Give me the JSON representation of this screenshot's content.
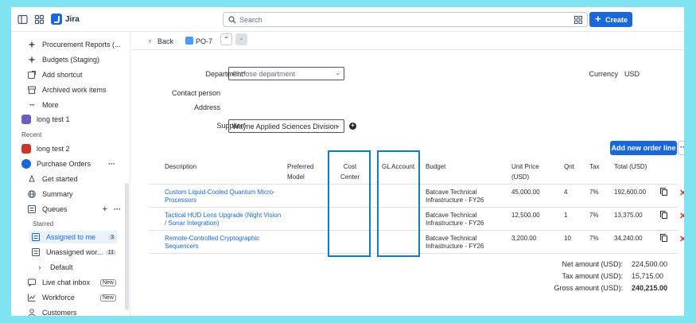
{
  "app": {
    "name": "Jira"
  },
  "search": {
    "placeholder": "Search"
  },
  "topbar": {
    "create_label": "Create"
  },
  "sidebar": {
    "items_top": [
      {
        "label": "Procurement Reports (...",
        "icon": "sparkle-icon"
      },
      {
        "label": "Budgets (Staging)",
        "icon": "sparkle-icon"
      },
      {
        "label": "Add shortcut",
        "icon": "add-shortcut-icon"
      },
      {
        "label": "Archived work items",
        "icon": "archive-icon"
      },
      {
        "label": "More",
        "icon": "more-icon"
      }
    ],
    "long_test_1": "long test 1",
    "recent_heading": "Recent",
    "long_test_2": "long test 2",
    "purchase_orders": "Purchase Orders",
    "get_started": "Get started",
    "summary": "Summary",
    "queues": "Queues",
    "starred_heading": "Starred",
    "assigned_to_me": "Assigned to me",
    "assigned_count": "3",
    "unassigned": "Unassigned wor...",
    "unassigned_count": "11",
    "default": "Default",
    "live_chat": "Live chat inbox",
    "live_chat_badge": "New",
    "workforce": "Workforce",
    "workforce_badge": "New",
    "customers": "Customers"
  },
  "breadcrumb": {
    "back": "Back",
    "issue_key": "PO-7"
  },
  "form": {
    "department_label": "Department*",
    "department_placeholder": "Choose department",
    "currency_label": "Currency",
    "currency_value": "USD",
    "contact_label": "Contact person",
    "address_label": "Address",
    "supplier_label": "Supplier*",
    "supplier_value": "Wayne Applied Sciences Division"
  },
  "order": {
    "add_line_label": "Add new order line",
    "more_label": "···",
    "headers": {
      "description": "Description",
      "preferred_model_1": "Preferred",
      "preferred_model_2": "Model",
      "cost_center_1": "Cost",
      "cost_center_2": "Center",
      "gl_account": "GL Account",
      "budget": "Budget",
      "unit_price_1": "Unit Price",
      "unit_price_2": "(USD)",
      "qnt": "Qnt",
      "tax": "Tax",
      "total": "Total (USD)"
    },
    "rows": [
      {
        "desc1": "Custom Liquid-Cooled Quantum Micro-",
        "desc2": "Processors",
        "budget1": "Batcave Technical",
        "budget2": "Infrastructure - FY26",
        "price": "45,000.00",
        "qnt": "4",
        "tax": "7%",
        "total": "192,600.00"
      },
      {
        "desc1": "Tactical HUD Lens Upgrade (Night Vision",
        "desc2": "/ Sonar Integration)",
        "budget1": "Batcave Technical",
        "budget2": "Infrastructure - FY26",
        "price": "12,500.00",
        "qnt": "1",
        "tax": "7%",
        "total": "13,375.00"
      },
      {
        "desc1": "Remote-Controlled Cryptographic",
        "desc2": "Sequencers",
        "budget1": "Batcave Technical",
        "budget2": "Infrastructure - FY26",
        "price": "3,200.00",
        "qnt": "10",
        "tax": "7%",
        "total": "34,240.00"
      }
    ]
  },
  "totals": {
    "net_label": "Net amount (USD):",
    "net_value": "224,500.00",
    "tax_label": "Tax amount (USD):",
    "tax_value": "15,715.00",
    "gross_label": "Gross amount (USD):",
    "gross_value": "240,215.00"
  },
  "colors": {
    "accent": "#1868db",
    "highlight": "#0a7fc8",
    "delete": "#d93025",
    "backdrop": "#7fe3f2"
  }
}
